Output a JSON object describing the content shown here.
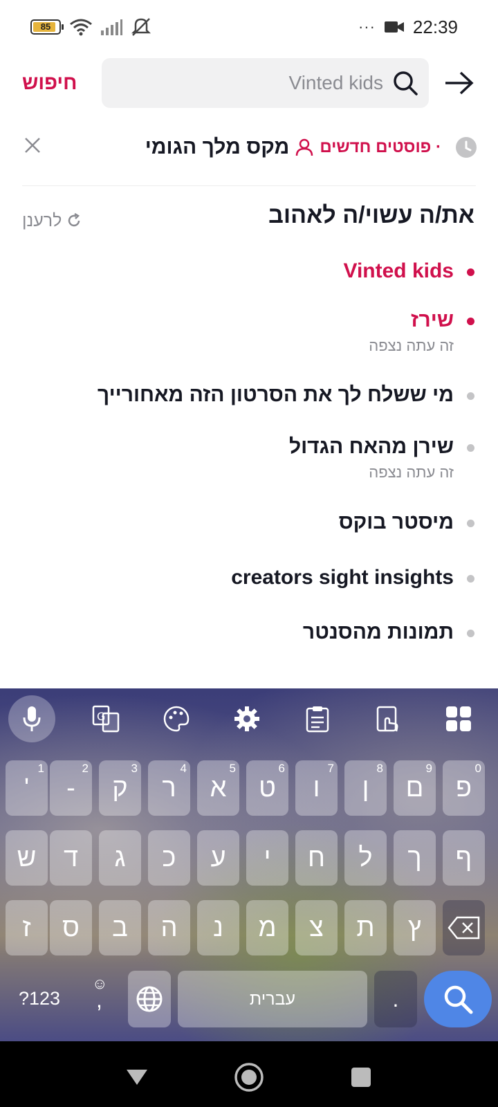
{
  "status_bar": {
    "battery": "85",
    "time": "22:39",
    "dots": "···",
    "icons": [
      "wifi-icon",
      "signal-icon",
      "mute-icon",
      "video-camera-icon"
    ]
  },
  "search": {
    "query": "Vinted kids",
    "action_label": "חיפוש"
  },
  "history": {
    "item": "מקס מלך הגומי",
    "badge": "· פוסטים חדשים"
  },
  "suggestions": {
    "title": "את/ה עשוי/ה לאהוב",
    "refresh_label": "לרענן",
    "items": [
      {
        "label": "Vinted kids",
        "sub": "",
        "hot": true
      },
      {
        "label": "שירז",
        "sub": "זה עתה נצפה",
        "hot": true
      },
      {
        "label": "מי ששלח לך את הסרטון הזה מאחורייך",
        "sub": "",
        "hot": false
      },
      {
        "label": "שירן מהאח הגדול",
        "sub": "זה עתה נצפה",
        "hot": false
      },
      {
        "label": "מיסטר בוקס",
        "sub": "",
        "hot": false
      },
      {
        "label": "creators sight insights",
        "sub": "",
        "hot": false
      },
      {
        "label": "תמונות מהסנטר",
        "sub": "",
        "hot": false
      }
    ]
  },
  "keyboard": {
    "row1": [
      "פ",
      "ם",
      "ן",
      "ו",
      "ט",
      "א",
      "ר",
      "ק",
      "-",
      "'"
    ],
    "row1_hints": [
      "0",
      "9",
      "8",
      "7",
      "6",
      "5",
      "4",
      "3",
      "2",
      "1"
    ],
    "row2": [
      "ף",
      "ך",
      "ל",
      "ח",
      "י",
      "ע",
      "כ",
      "ג",
      "ד",
      "ש"
    ],
    "row3": [
      "ץ",
      "ת",
      "צ",
      "מ",
      "נ",
      "ה",
      "ב",
      "ס",
      "ז"
    ],
    "symbols_label": "?123",
    "comma": ",",
    "space_label": "עברית",
    "period": "."
  }
}
